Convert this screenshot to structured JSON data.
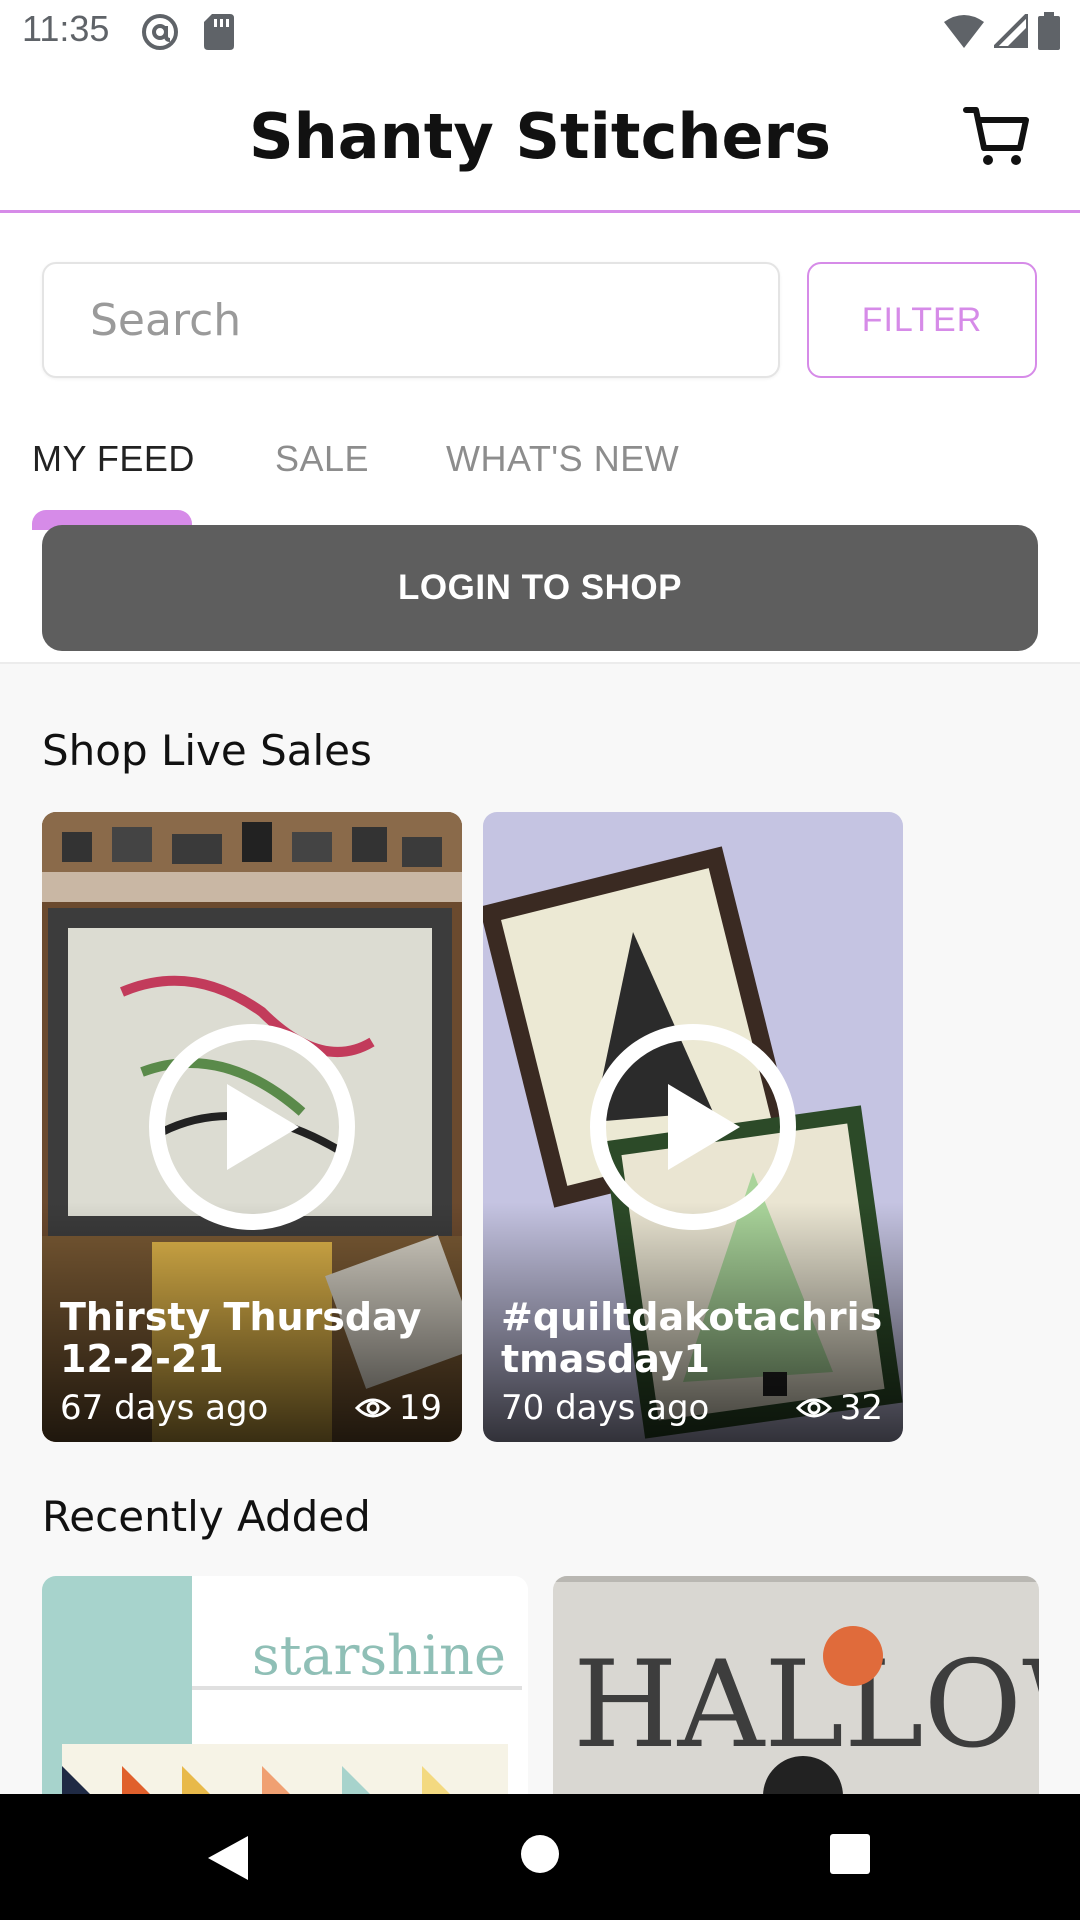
{
  "status_bar": {
    "time": "11:35",
    "icons": [
      "at-sign-icon",
      "sd-card-icon",
      "wifi-icon",
      "signal-icon",
      "battery-icon"
    ]
  },
  "header": {
    "title": "Shanty Stitchers",
    "cart_icon": "cart-icon"
  },
  "search": {
    "placeholder": "Search",
    "value": "",
    "filter_label": "FILTER"
  },
  "tabs": [
    {
      "label": "MY FEED",
      "active": true
    },
    {
      "label": "SALE",
      "active": false
    },
    {
      "label": "WHAT'S NEW",
      "active": false
    }
  ],
  "login_button": "LOGIN TO SHOP",
  "live_sales": {
    "heading": "Shop Live Sales",
    "items": [
      {
        "title": "Thirsty Thursday 12-2-21",
        "age": "67 days ago",
        "views": "19"
      },
      {
        "title": "#quiltdakotachristmasday1",
        "age": "70 days ago",
        "views": "32"
      }
    ]
  },
  "recently_added": {
    "heading": "Recently Added",
    "items": [
      {
        "image_text": "starshine"
      },
      {
        "image_text": "HALLOWEEN"
      }
    ]
  },
  "colors": {
    "accent": "#d68be8",
    "login_button_bg": "#5e5e5e",
    "content_bg": "#f8f8f8"
  },
  "nav_bar": {
    "icons": [
      "back-icon",
      "home-icon",
      "recents-icon"
    ]
  }
}
